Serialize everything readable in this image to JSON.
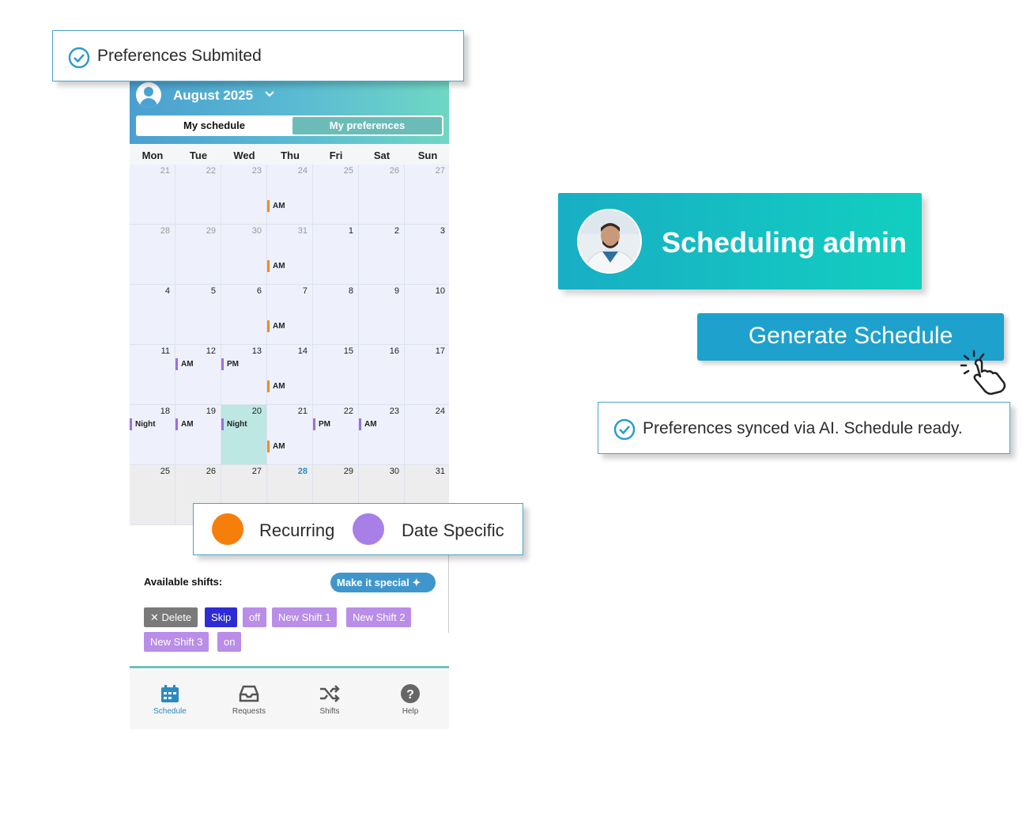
{
  "header": {
    "month": "August 2025"
  },
  "tabs": [
    {
      "label": "My schedule"
    },
    {
      "label": "My preferences"
    }
  ],
  "weekdays": [
    "Mon",
    "Tue",
    "Wed",
    "Thu",
    "Fri",
    "Sat",
    "Sun"
  ],
  "weeks": [
    [
      {
        "day": "21",
        "muted": true
      },
      {
        "day": "22",
        "muted": true
      },
      {
        "day": "23",
        "muted": true
      },
      {
        "day": "24",
        "muted": true,
        "tags": [
          {
            "label": "AM",
            "kind": "rec",
            "row": 2
          }
        ]
      },
      {
        "day": "25",
        "muted": true
      },
      {
        "day": "26",
        "muted": true
      },
      {
        "day": "27",
        "muted": true
      }
    ],
    [
      {
        "day": "28",
        "muted": true
      },
      {
        "day": "29",
        "muted": true
      },
      {
        "day": "30",
        "muted": true
      },
      {
        "day": "31",
        "muted": true,
        "tags": [
          {
            "label": "AM",
            "kind": "rec",
            "row": 2
          }
        ]
      },
      {
        "day": "1"
      },
      {
        "day": "2"
      },
      {
        "day": "3"
      }
    ],
    [
      {
        "day": "4"
      },
      {
        "day": "5"
      },
      {
        "day": "6"
      },
      {
        "day": "7",
        "tags": [
          {
            "label": "AM",
            "kind": "rec",
            "row": 2
          }
        ]
      },
      {
        "day": "8"
      },
      {
        "day": "9"
      },
      {
        "day": "10"
      }
    ],
    [
      {
        "day": "11"
      },
      {
        "day": "12",
        "tags": [
          {
            "label": "AM",
            "kind": "spec",
            "row": 1
          }
        ]
      },
      {
        "day": "13",
        "tags": [
          {
            "label": "PM",
            "kind": "spec",
            "row": 1
          }
        ]
      },
      {
        "day": "14",
        "tags": [
          {
            "label": "AM",
            "kind": "rec",
            "row": 2
          }
        ]
      },
      {
        "day": "15"
      },
      {
        "day": "16"
      },
      {
        "day": "17"
      }
    ],
    [
      {
        "day": "18",
        "tags": [
          {
            "label": "Night",
            "kind": "spec",
            "row": 1
          }
        ]
      },
      {
        "day": "19",
        "tags": [
          {
            "label": "AM",
            "kind": "spec",
            "row": 1
          }
        ]
      },
      {
        "day": "20",
        "today": true,
        "tags": [
          {
            "label": "Night",
            "kind": "spec",
            "row": 1
          }
        ]
      },
      {
        "day": "21",
        "tags": [
          {
            "label": "AM",
            "kind": "rec",
            "row": 2
          }
        ]
      },
      {
        "day": "22",
        "tags": [
          {
            "label": "PM",
            "kind": "spec",
            "row": 1
          }
        ]
      },
      {
        "day": "23",
        "tags": [
          {
            "label": "AM",
            "kind": "spec",
            "row": 1
          }
        ]
      },
      {
        "day": "24"
      }
    ],
    [
      {
        "day": "25",
        "gray": true
      },
      {
        "day": "26",
        "gray": true
      },
      {
        "day": "27",
        "gray": true
      },
      {
        "day": "28",
        "gray": true,
        "accent": true
      },
      {
        "day": "29",
        "gray": true
      },
      {
        "day": "30",
        "gray": true
      },
      {
        "day": "31",
        "gray": true
      }
    ]
  ],
  "available_label": "Available shifts:",
  "make_special_label": "Make it special ✦",
  "shift_chips": [
    {
      "label": "✕ Delete",
      "style": "gray"
    },
    {
      "label": "Skip",
      "style": "blue"
    },
    {
      "label": "off",
      "style": "purple"
    },
    {
      "label": "New Shift 1",
      "style": "purple"
    },
    {
      "label": "New Shift 2",
      "style": "purple"
    },
    {
      "label": "New Shift 3",
      "style": "purple"
    },
    {
      "label": "on",
      "style": "purple"
    }
  ],
  "bottom_nav": [
    {
      "label": "Schedule",
      "icon": "calendar-icon",
      "active": true
    },
    {
      "label": "Requests",
      "icon": "inbox-icon"
    },
    {
      "label": "Shifts",
      "icon": "shuffle-icon"
    },
    {
      "label": "Help",
      "icon": "help-icon"
    }
  ],
  "toast_top": "Preferences Submited",
  "legend": {
    "recurring": "Recurring",
    "date_specific": "Date Specific"
  },
  "admin": {
    "title": "Scheduling admin"
  },
  "generate_button": "Generate Schedule",
  "toast_bottom": "Preferences synced via AI. Schedule ready.",
  "colors": {
    "recurring": "#f08a2a",
    "date_specific": "#a77fe6",
    "accent": "#1ea1cc"
  }
}
